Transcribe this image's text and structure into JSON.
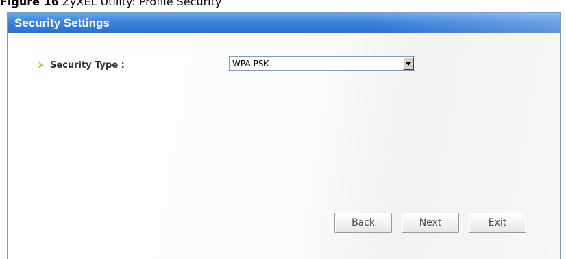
{
  "caption": {
    "prefix": "Figure 16",
    "text": "ZyXEL Utility: Profile Security"
  },
  "window": {
    "title": "Security Settings"
  },
  "form": {
    "security_type_label": "Security Type :",
    "security_type_value": "WPA-PSK"
  },
  "buttons": {
    "back": "Back",
    "next": "Next",
    "exit": "Exit"
  },
  "colors": {
    "title_bar": "#3a82dc",
    "bullet": "#8cc63f"
  },
  "icons": {
    "bullet": "arrow-bullet-icon",
    "dropdown": "dropdown-arrow-icon"
  }
}
